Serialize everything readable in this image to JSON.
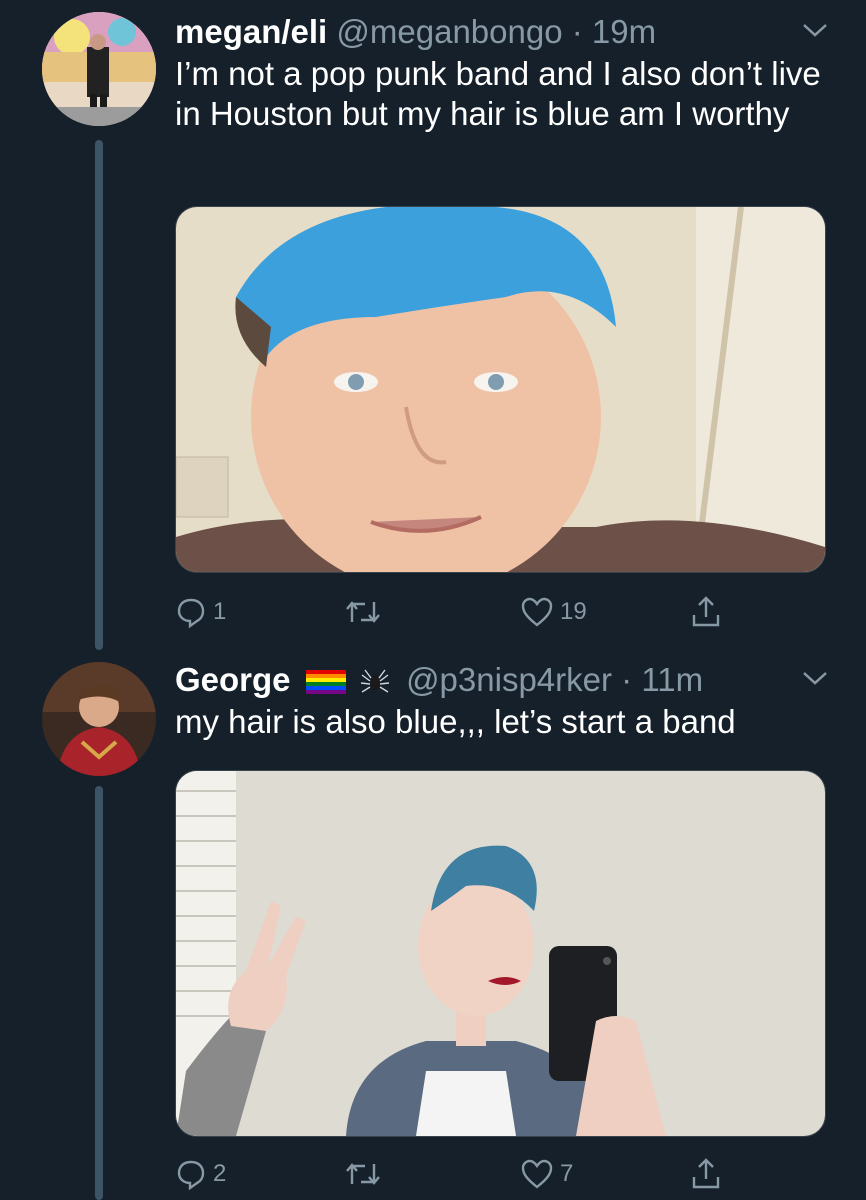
{
  "tweets": [
    {
      "display_name": "megan/eli",
      "handle": "@meganbongo",
      "separator": " · ",
      "time": "19m",
      "text": "I’m not a pop punk band and I also don’t live in Houston but my hair is blue am I worthy",
      "replies": "1",
      "retweets": "",
      "likes": "19",
      "media_desc": "selfie-blue-hair"
    },
    {
      "display_name": "George",
      "handle": "@p3nisp4rker",
      "separator": " · ",
      "time": "11m",
      "text": "my hair is also blue,,, let’s start a band",
      "replies": "2",
      "retweets": "",
      "likes": "7",
      "media_desc": "mirror-selfie-peace-sign"
    }
  ],
  "icons": {
    "reply": "reply-icon",
    "retweet": "retweet-icon",
    "like": "heart-icon",
    "share": "share-icon",
    "more": "chevron-down-icon"
  },
  "colors": {
    "background": "#15202b",
    "secondary_text": "#8899a6",
    "thread_line": "#3d5466"
  }
}
